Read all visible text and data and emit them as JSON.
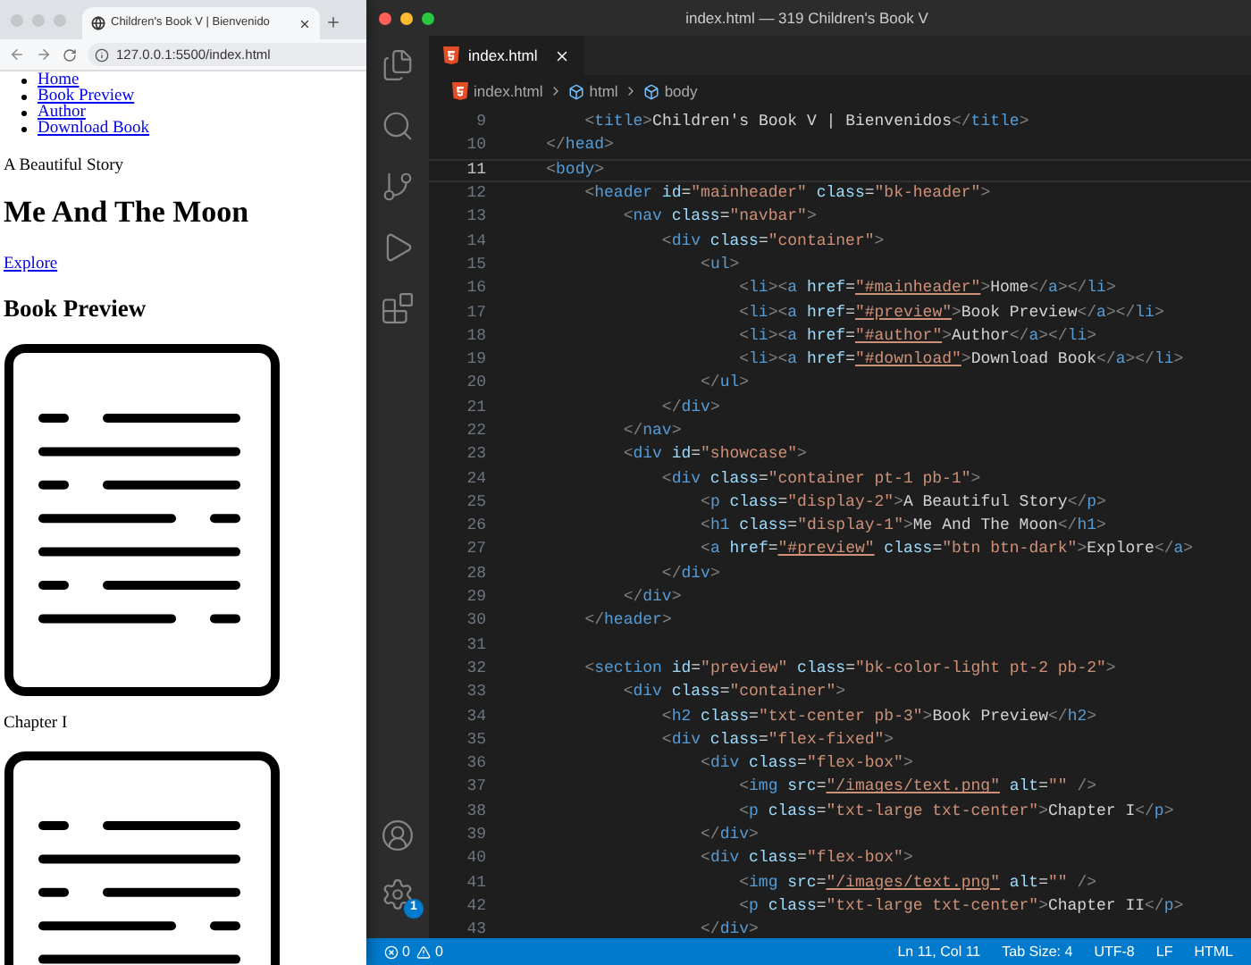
{
  "browser": {
    "tab": {
      "title": "Children's Book V | Bienvenido",
      "selected": true
    },
    "url": "127.0.0.1:5500/index.html",
    "page": {
      "nav_links": [
        "Home",
        "Book Preview",
        "Author",
        "Download Book"
      ],
      "tagline": "A Beautiful Story",
      "heading": "Me And The Moon",
      "explore_link": "Explore",
      "section_heading": "Book Preview",
      "chapters": [
        {
          "kind": "captioned",
          "caption": "Chapter I"
        },
        {
          "kind": "image"
        }
      ]
    }
  },
  "editor": {
    "window_title": "index.html — 319 Children's Book V",
    "tab": {
      "label": "index.html",
      "selected": true
    },
    "breadcrumb": [
      {
        "kind": "file",
        "label": "index.html"
      },
      {
        "kind": "element",
        "label": "html"
      },
      {
        "kind": "element",
        "label": "body"
      }
    ],
    "lines": [
      {
        "number": "9",
        "current": false,
        "code": "        <title>Children's Book V | Bienvenidos</title>"
      },
      {
        "number": "10",
        "current": false,
        "code": "    </head>"
      },
      {
        "number": "11",
        "current": true,
        "code": "    <body>"
      },
      {
        "number": "12",
        "current": false,
        "code": "        <header id=\"mainheader\" class=\"bk-header\">"
      },
      {
        "number": "13",
        "current": false,
        "code": "            <nav class=\"navbar\">"
      },
      {
        "number": "14",
        "current": false,
        "code": "                <div class=\"container\">"
      },
      {
        "number": "15",
        "current": false,
        "code": "                    <ul>"
      },
      {
        "number": "16",
        "current": false,
        "code": "                        <li><a href=\"#mainheader\">Home</a></li>"
      },
      {
        "number": "17",
        "current": false,
        "code": "                        <li><a href=\"#preview\">Book Preview</a></li>"
      },
      {
        "number": "18",
        "current": false,
        "code": "                        <li><a href=\"#author\">Author</a></li>"
      },
      {
        "number": "19",
        "current": false,
        "code": "                        <li><a href=\"#download\">Download Book</a></li>"
      },
      {
        "number": "20",
        "current": false,
        "code": "                    </ul>"
      },
      {
        "number": "21",
        "current": false,
        "code": "                </div>"
      },
      {
        "number": "22",
        "current": false,
        "code": "            </nav>"
      },
      {
        "number": "23",
        "current": false,
        "code": "            <div id=\"showcase\">"
      },
      {
        "number": "24",
        "current": false,
        "code": "                <div class=\"container pt-1 pb-1\">"
      },
      {
        "number": "25",
        "current": false,
        "code": "                    <p class=\"display-2\">A Beautiful Story</p>"
      },
      {
        "number": "26",
        "current": false,
        "code": "                    <h1 class=\"display-1\">Me And The Moon</h1>"
      },
      {
        "number": "27",
        "current": false,
        "code": "                    <a href=\"#preview\" class=\"btn btn-dark\">Explore</a>"
      },
      {
        "number": "28",
        "current": false,
        "code": "                </div>"
      },
      {
        "number": "29",
        "current": false,
        "code": "            </div>"
      },
      {
        "number": "30",
        "current": false,
        "code": "        </header>"
      },
      {
        "number": "31",
        "current": false
      },
      {
        "number": "32",
        "current": false,
        "code": "        <section id=\"preview\" class=\"bk-color-light pt-2 pb-2\">"
      },
      {
        "number": "33",
        "current": false,
        "code": "            <div class=\"container\">"
      },
      {
        "number": "34",
        "current": false,
        "code": "                <h2 class=\"txt-center pb-3\">Book Preview</h2>"
      },
      {
        "number": "35",
        "current": false,
        "code": "                <div class=\"flex-fixed\">"
      },
      {
        "number": "36",
        "current": false,
        "code": "                    <div class=\"flex-box\">"
      },
      {
        "number": "37",
        "current": false,
        "code": "                        <img src=\"/images/text.png\" alt=\"\" />"
      },
      {
        "number": "38",
        "current": false,
        "code": "                        <p class=\"txt-large txt-center\">Chapter I</p>"
      },
      {
        "number": "39",
        "current": false,
        "code": "                    </div>"
      },
      {
        "number": "40",
        "current": false,
        "code": "                    <div class=\"flex-box\">"
      },
      {
        "number": "41",
        "current": false,
        "code": "                        <img src=\"/images/text.png\" alt=\"\" />"
      },
      {
        "number": "42",
        "current": false,
        "code": "                        <p class=\"txt-large txt-center\">Chapter II</p>"
      },
      {
        "number": "43",
        "current": false,
        "code": "                    </div>"
      }
    ],
    "settings_badge": "1",
    "status_bar": {
      "errors": "0",
      "warnings": "0",
      "items": [
        "Ln 11, Col 11",
        "Tab Size: 4",
        "UTF-8",
        "LF",
        "HTML"
      ]
    }
  }
}
